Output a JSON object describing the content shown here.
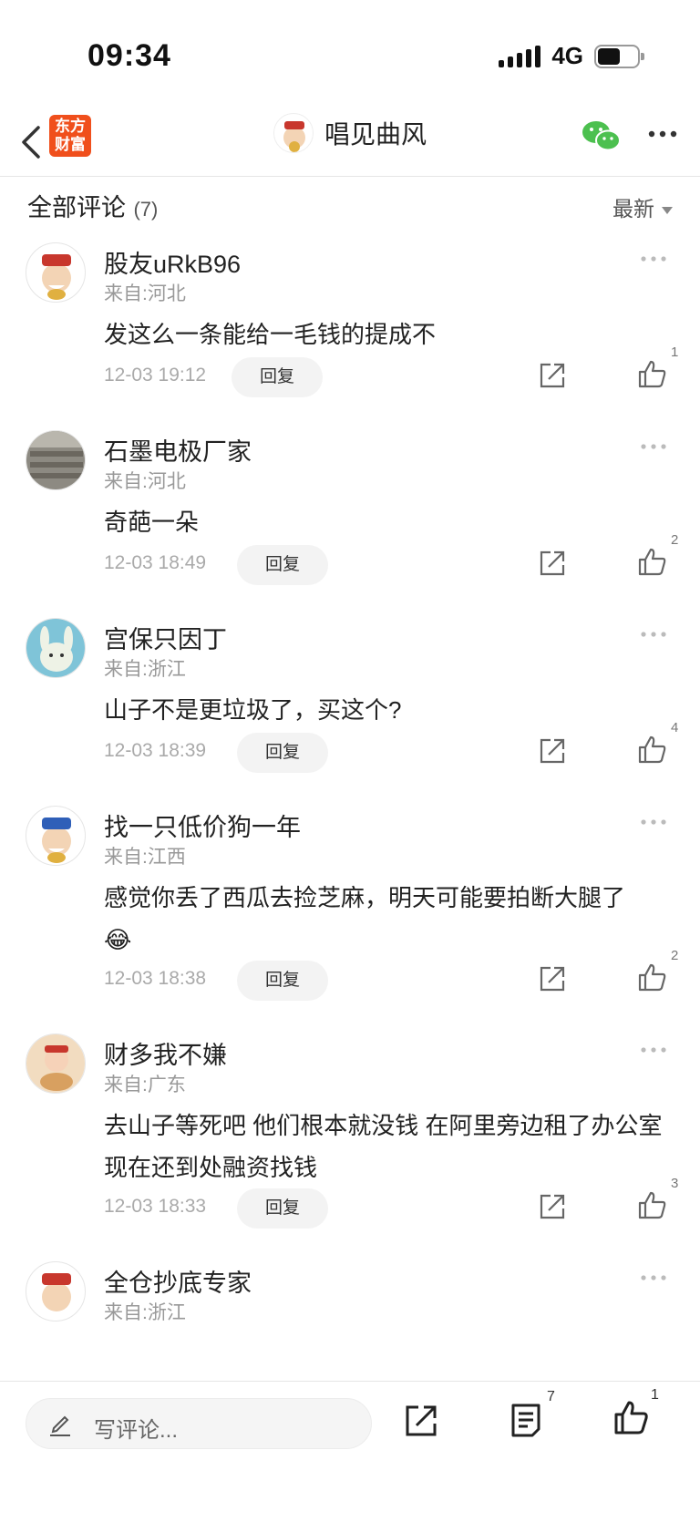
{
  "status_bar": {
    "time": "09:34",
    "network": "4G"
  },
  "nav": {
    "logo_text": "东方财富",
    "title": "唱见曲风"
  },
  "comments_header": {
    "title": "全部评论",
    "count": "(7)",
    "sort_label": "最新"
  },
  "comments": [
    {
      "user": "股友uRkB96",
      "location": "来自:河北",
      "text": "发这么一条能给一毛钱的提成不",
      "date": "12-03 19:12",
      "reply_label": "回复",
      "likes": "1"
    },
    {
      "user": "石墨电极厂家",
      "location": "来自:河北",
      "text": "奇葩一朵",
      "date": "12-03 18:49",
      "reply_label": "回复",
      "likes": "2"
    },
    {
      "user": "宫保只因丁",
      "location": "来自:浙江",
      "text": "山子不是更垃圾了，买这个?",
      "date": "12-03 18:39",
      "reply_label": "回复",
      "likes": "4"
    },
    {
      "user": "找一只低价狗一年",
      "location": "来自:江西",
      "text": "感觉你丢了西瓜去捡芝麻，明天可能要拍断大腿了",
      "emoji": "😂",
      "date": "12-03 18:38",
      "reply_label": "回复",
      "likes": "2"
    },
    {
      "user": "财多我不嫌",
      "location": "来自:广东",
      "text": "去山子等死吧 他们根本就没钱 在阿里旁边租了办公室现在还到处融资找钱",
      "date": "12-03 18:33",
      "reply_label": "回复",
      "likes": "3"
    },
    {
      "user": "全仓抄底专家",
      "location": "来自:浙江"
    }
  ],
  "bottom_bar": {
    "input_placeholder": "写评论...",
    "comment_count": "7",
    "like_count": "1"
  }
}
